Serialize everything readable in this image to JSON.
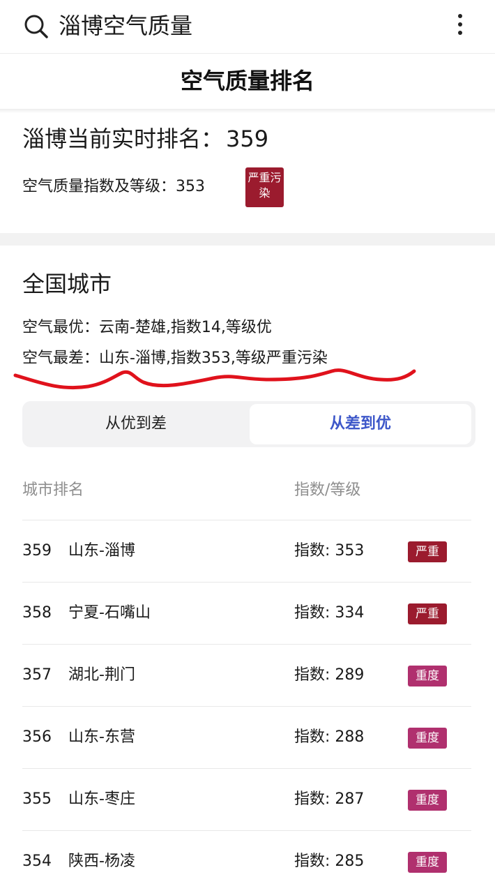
{
  "search": {
    "query": "淄博空气质量"
  },
  "header": {
    "title": "空气质量排名"
  },
  "local": {
    "rank_label": "淄博当前实时排名：",
    "rank_value": "359",
    "aqi_line": "空气质量指数及等级：353",
    "level": "严重污染"
  },
  "national": {
    "title": "全国城市",
    "best_line": "空气最优：云南-楚雄,指数14,等级优",
    "worst_line": "空气最差：山东-淄博,指数353,等级严重污染"
  },
  "sort": {
    "options": [
      "从优到差",
      "从差到优"
    ],
    "selected": "从差到优"
  },
  "table": {
    "headers": {
      "rank": "城市排名",
      "index": "指数/等级"
    },
    "rows": [
      {
        "rank": "359",
        "city": "山东-淄博",
        "index": "指数: 353",
        "level": "严重"
      },
      {
        "rank": "358",
        "city": "宁夏-石嘴山",
        "index": "指数: 334",
        "level": "严重"
      },
      {
        "rank": "357",
        "city": "湖北-荆门",
        "index": "指数: 289",
        "level": "重度"
      },
      {
        "rank": "356",
        "city": "山东-东营",
        "index": "指数: 288",
        "level": "重度"
      },
      {
        "rank": "355",
        "city": "山东-枣庄",
        "index": "指数: 287",
        "level": "重度"
      },
      {
        "rank": "354",
        "city": "陕西-杨凌",
        "index": "指数: 285",
        "level": "重度"
      }
    ]
  },
  "colors": {
    "severe": "#9b1b2e",
    "heavy": "#b0306e",
    "accent": "#3d57c9",
    "annotation": "#e0121c"
  },
  "icons": {
    "search": "search-icon",
    "more": "more-vertical-icon"
  }
}
